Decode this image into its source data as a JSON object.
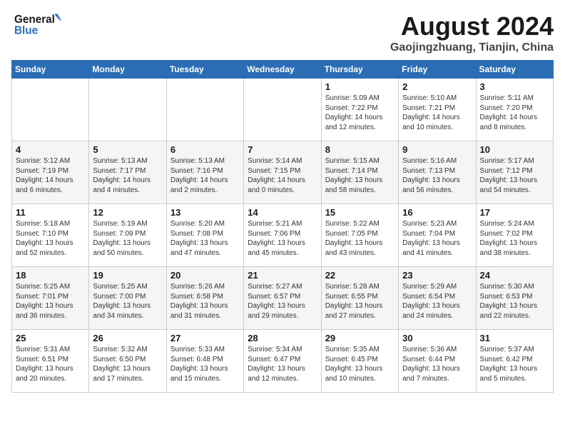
{
  "logo": {
    "line1": "General",
    "line2": "Blue"
  },
  "title": "August 2024",
  "location": "Gaojingzhuang, Tianjin, China",
  "days_of_week": [
    "Sunday",
    "Monday",
    "Tuesday",
    "Wednesday",
    "Thursday",
    "Friday",
    "Saturday"
  ],
  "weeks": [
    [
      {
        "day": "",
        "info": ""
      },
      {
        "day": "",
        "info": ""
      },
      {
        "day": "",
        "info": ""
      },
      {
        "day": "",
        "info": ""
      },
      {
        "day": "1",
        "info": "Sunrise: 5:09 AM\nSunset: 7:22 PM\nDaylight: 14 hours\nand 12 minutes."
      },
      {
        "day": "2",
        "info": "Sunrise: 5:10 AM\nSunset: 7:21 PM\nDaylight: 14 hours\nand 10 minutes."
      },
      {
        "day": "3",
        "info": "Sunrise: 5:11 AM\nSunset: 7:20 PM\nDaylight: 14 hours\nand 8 minutes."
      }
    ],
    [
      {
        "day": "4",
        "info": "Sunrise: 5:12 AM\nSunset: 7:19 PM\nDaylight: 14 hours\nand 6 minutes."
      },
      {
        "day": "5",
        "info": "Sunrise: 5:13 AM\nSunset: 7:17 PM\nDaylight: 14 hours\nand 4 minutes."
      },
      {
        "day": "6",
        "info": "Sunrise: 5:13 AM\nSunset: 7:16 PM\nDaylight: 14 hours\nand 2 minutes."
      },
      {
        "day": "7",
        "info": "Sunrise: 5:14 AM\nSunset: 7:15 PM\nDaylight: 14 hours\nand 0 minutes."
      },
      {
        "day": "8",
        "info": "Sunrise: 5:15 AM\nSunset: 7:14 PM\nDaylight: 13 hours\nand 58 minutes."
      },
      {
        "day": "9",
        "info": "Sunrise: 5:16 AM\nSunset: 7:13 PM\nDaylight: 13 hours\nand 56 minutes."
      },
      {
        "day": "10",
        "info": "Sunrise: 5:17 AM\nSunset: 7:12 PM\nDaylight: 13 hours\nand 54 minutes."
      }
    ],
    [
      {
        "day": "11",
        "info": "Sunrise: 5:18 AM\nSunset: 7:10 PM\nDaylight: 13 hours\nand 52 minutes."
      },
      {
        "day": "12",
        "info": "Sunrise: 5:19 AM\nSunset: 7:09 PM\nDaylight: 13 hours\nand 50 minutes."
      },
      {
        "day": "13",
        "info": "Sunrise: 5:20 AM\nSunset: 7:08 PM\nDaylight: 13 hours\nand 47 minutes."
      },
      {
        "day": "14",
        "info": "Sunrise: 5:21 AM\nSunset: 7:06 PM\nDaylight: 13 hours\nand 45 minutes."
      },
      {
        "day": "15",
        "info": "Sunrise: 5:22 AM\nSunset: 7:05 PM\nDaylight: 13 hours\nand 43 minutes."
      },
      {
        "day": "16",
        "info": "Sunrise: 5:23 AM\nSunset: 7:04 PM\nDaylight: 13 hours\nand 41 minutes."
      },
      {
        "day": "17",
        "info": "Sunrise: 5:24 AM\nSunset: 7:02 PM\nDaylight: 13 hours\nand 38 minutes."
      }
    ],
    [
      {
        "day": "18",
        "info": "Sunrise: 5:25 AM\nSunset: 7:01 PM\nDaylight: 13 hours\nand 36 minutes."
      },
      {
        "day": "19",
        "info": "Sunrise: 5:25 AM\nSunset: 7:00 PM\nDaylight: 13 hours\nand 34 minutes."
      },
      {
        "day": "20",
        "info": "Sunrise: 5:26 AM\nSunset: 6:58 PM\nDaylight: 13 hours\nand 31 minutes."
      },
      {
        "day": "21",
        "info": "Sunrise: 5:27 AM\nSunset: 6:57 PM\nDaylight: 13 hours\nand 29 minutes."
      },
      {
        "day": "22",
        "info": "Sunrise: 5:28 AM\nSunset: 6:55 PM\nDaylight: 13 hours\nand 27 minutes."
      },
      {
        "day": "23",
        "info": "Sunrise: 5:29 AM\nSunset: 6:54 PM\nDaylight: 13 hours\nand 24 minutes."
      },
      {
        "day": "24",
        "info": "Sunrise: 5:30 AM\nSunset: 6:53 PM\nDaylight: 13 hours\nand 22 minutes."
      }
    ],
    [
      {
        "day": "25",
        "info": "Sunrise: 5:31 AM\nSunset: 6:51 PM\nDaylight: 13 hours\nand 20 minutes."
      },
      {
        "day": "26",
        "info": "Sunrise: 5:32 AM\nSunset: 6:50 PM\nDaylight: 13 hours\nand 17 minutes."
      },
      {
        "day": "27",
        "info": "Sunrise: 5:33 AM\nSunset: 6:48 PM\nDaylight: 13 hours\nand 15 minutes."
      },
      {
        "day": "28",
        "info": "Sunrise: 5:34 AM\nSunset: 6:47 PM\nDaylight: 13 hours\nand 12 minutes."
      },
      {
        "day": "29",
        "info": "Sunrise: 5:35 AM\nSunset: 6:45 PM\nDaylight: 13 hours\nand 10 minutes."
      },
      {
        "day": "30",
        "info": "Sunrise: 5:36 AM\nSunset: 6:44 PM\nDaylight: 13 hours\nand 7 minutes."
      },
      {
        "day": "31",
        "info": "Sunrise: 5:37 AM\nSunset: 6:42 PM\nDaylight: 13 hours\nand 5 minutes."
      }
    ]
  ]
}
